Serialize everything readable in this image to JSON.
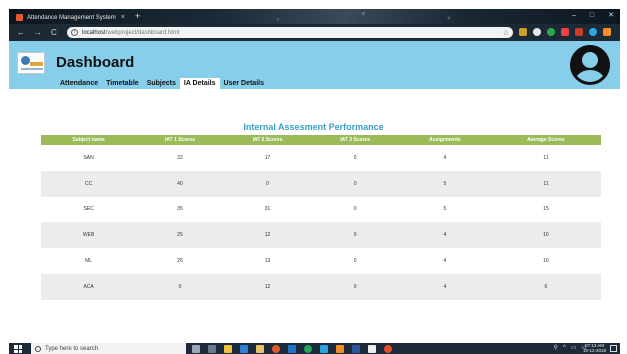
{
  "browser": {
    "tab_title": "Attendance Management System",
    "tab_close": "×",
    "new_tab": "+",
    "url_host": "localhost",
    "url_path": "/webproject/dashboard.html",
    "window_controls": [
      "–",
      "□",
      "✕"
    ]
  },
  "header": {
    "title": "Dashboard",
    "nav": [
      "Attendance",
      "Timetable",
      "Subjects",
      "IA Details",
      "User Details"
    ],
    "active_nav": "IA Details",
    "colors": {
      "header_bg": "#87ceeb",
      "table_header": "#9bbb59",
      "section_title": "#3aa0c4"
    }
  },
  "main": {
    "section_title": "Internal Assesment Performance",
    "columns": [
      "Subject name",
      "IAT 1 Scores",
      "IAT 2 Scores",
      "IAT 3 Scores",
      "Assignments",
      "Average Scores"
    ],
    "rows": [
      [
        "SAN",
        "32",
        "17",
        "0",
        "4",
        "11"
      ],
      [
        "CC",
        "40",
        "0",
        "0",
        "5",
        "11"
      ],
      [
        "SEC",
        "35",
        "31",
        "0",
        "5",
        "15"
      ],
      [
        "WEB",
        "25",
        "12",
        "0",
        "4",
        "10"
      ],
      [
        "ML",
        "26",
        "13",
        "0",
        "4",
        "10"
      ],
      [
        "ACA",
        "0",
        "12",
        "0",
        "4",
        "6"
      ]
    ]
  },
  "taskbar": {
    "search_placeholder": "Type here to search",
    "clock_time": "07:13 AM",
    "clock_date": "12-12-2018"
  }
}
